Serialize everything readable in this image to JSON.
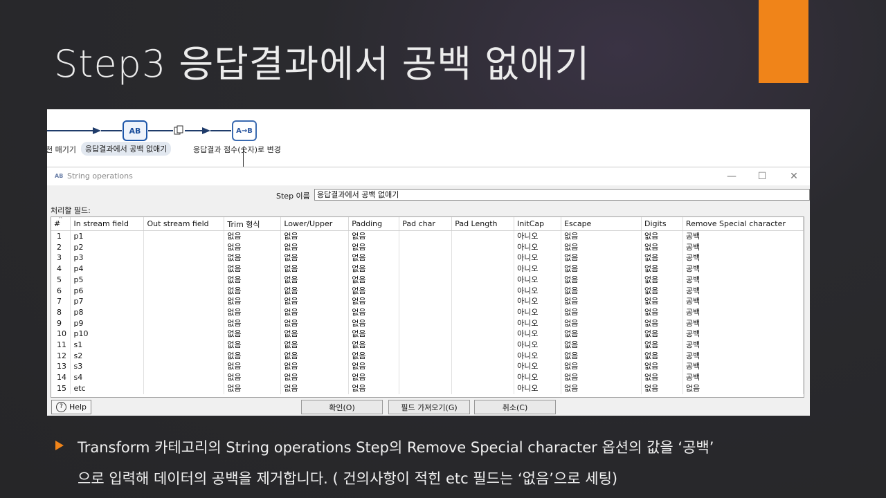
{
  "slide": {
    "title": "Step3 응답결과에서 공백 없애기",
    "bullet_line1": "Transform 카테고리의 String operations Step의 Remove Special character 옵션의 값을 ‘공백’",
    "bullet_line2": "으로 입력해 데이터의 공백을 제거합니다. ( 건의사항이 적힌 etc 필드는 ‘없음’으로 세팅)",
    "accent_color": "#f08419"
  },
  "canvas": {
    "steps": [
      {
        "label": "천 매기기",
        "icon": "ellipsis"
      },
      {
        "label": "응답결과에서 공백 없애기",
        "icon": "string-operations-icon",
        "selected": true
      },
      {
        "label": "응답결과 점수(숫자)로 변경",
        "icon": "replace-in-string-icon"
      }
    ],
    "icon_text_1": "AB",
    "icon_text_2": "A→B"
  },
  "dialog": {
    "title": "String operations",
    "title_icon": "AB",
    "minimize": "—",
    "maximize": "☐",
    "close": "✕",
    "step_name_label": "Step 이름",
    "step_name_value": "응답결과에서 공백 없애기",
    "fields_label": "처리할 필드:",
    "columns": [
      "#",
      "In stream field",
      "Out stream field",
      "Trim 형식",
      "Lower/Upper",
      "Padding",
      "Pad char",
      "Pad Length",
      "InitCap",
      "Escape",
      "Digits",
      "Remove Special character"
    ],
    "rows": [
      [
        "1",
        "p1",
        "",
        "없음",
        "없음",
        "없음",
        "",
        "",
        "아니오",
        "없음",
        "없음",
        "공백"
      ],
      [
        "2",
        "p2",
        "",
        "없음",
        "없음",
        "없음",
        "",
        "",
        "아니오",
        "없음",
        "없음",
        "공백"
      ],
      [
        "3",
        "p3",
        "",
        "없음",
        "없음",
        "없음",
        "",
        "",
        "아니오",
        "없음",
        "없음",
        "공백"
      ],
      [
        "4",
        "p4",
        "",
        "없음",
        "없음",
        "없음",
        "",
        "",
        "아니오",
        "없음",
        "없음",
        "공백"
      ],
      [
        "5",
        "p5",
        "",
        "없음",
        "없음",
        "없음",
        "",
        "",
        "아니오",
        "없음",
        "없음",
        "공백"
      ],
      [
        "6",
        "p6",
        "",
        "없음",
        "없음",
        "없음",
        "",
        "",
        "아니오",
        "없음",
        "없음",
        "공백"
      ],
      [
        "7",
        "p7",
        "",
        "없음",
        "없음",
        "없음",
        "",
        "",
        "아니오",
        "없음",
        "없음",
        "공백"
      ],
      [
        "8",
        "p8",
        "",
        "없음",
        "없음",
        "없음",
        "",
        "",
        "아니오",
        "없음",
        "없음",
        "공백"
      ],
      [
        "9",
        "p9",
        "",
        "없음",
        "없음",
        "없음",
        "",
        "",
        "아니오",
        "없음",
        "없음",
        "공백"
      ],
      [
        "10",
        "p10",
        "",
        "없음",
        "없음",
        "없음",
        "",
        "",
        "아니오",
        "없음",
        "없음",
        "공백"
      ],
      [
        "11",
        "s1",
        "",
        "없음",
        "없음",
        "없음",
        "",
        "",
        "아니오",
        "없음",
        "없음",
        "공백"
      ],
      [
        "12",
        "s2",
        "",
        "없음",
        "없음",
        "없음",
        "",
        "",
        "아니오",
        "없음",
        "없음",
        "공백"
      ],
      [
        "13",
        "s3",
        "",
        "없음",
        "없음",
        "없음",
        "",
        "",
        "아니오",
        "없음",
        "없음",
        "공백"
      ],
      [
        "14",
        "s4",
        "",
        "없음",
        "없음",
        "없음",
        "",
        "",
        "아니오",
        "없음",
        "없음",
        "공백"
      ],
      [
        "15",
        "etc",
        "",
        "없음",
        "없음",
        "없음",
        "",
        "",
        "아니오",
        "없음",
        "없음",
        "없음"
      ]
    ],
    "help_label": "Help",
    "help_icon": "?",
    "ok_label": "확인(O)",
    "get_fields_label": "필드 가져오기(G)",
    "cancel_label": "취소(C)"
  }
}
